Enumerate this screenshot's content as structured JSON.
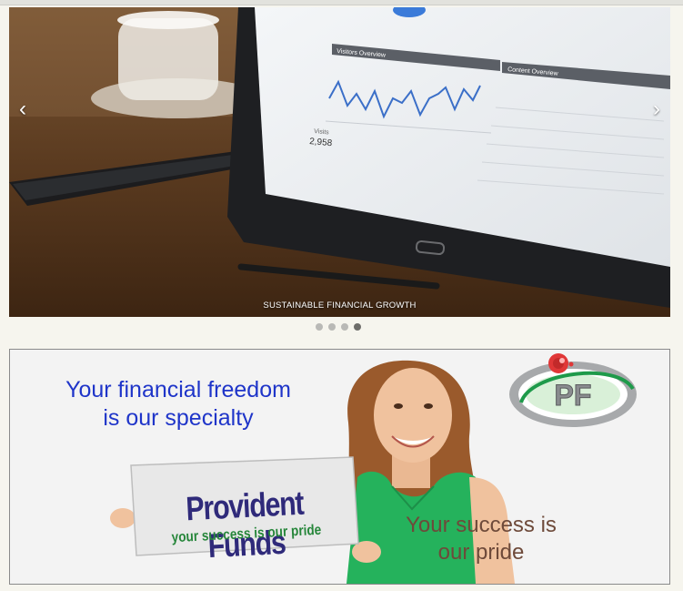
{
  "carousel": {
    "prev_label": "‹",
    "next_label": "›",
    "caption": "SUSTAINABLE FINANCIAL GROWTH",
    "slides_count": 4,
    "active_index": 3,
    "tablet_screen": {
      "chart_title": "Visitors Overview",
      "panel_title": "Content Overview",
      "visits_label": "Visits",
      "visits_value": "2,958"
    }
  },
  "banner": {
    "headline_line1": "Your financial freedom",
    "headline_line2": "is our specialty",
    "sign_title": "Provident Funds",
    "sign_subtitle": "your success is our pride",
    "slogan_line1": "Your success is",
    "slogan_line2": "our pride",
    "logo_text": "PF"
  },
  "colors": {
    "headline": "#1f35c9",
    "sign_title": "#2f2a7a",
    "sign_subtitle": "#26863a",
    "slogan": "#6e4a3a"
  }
}
